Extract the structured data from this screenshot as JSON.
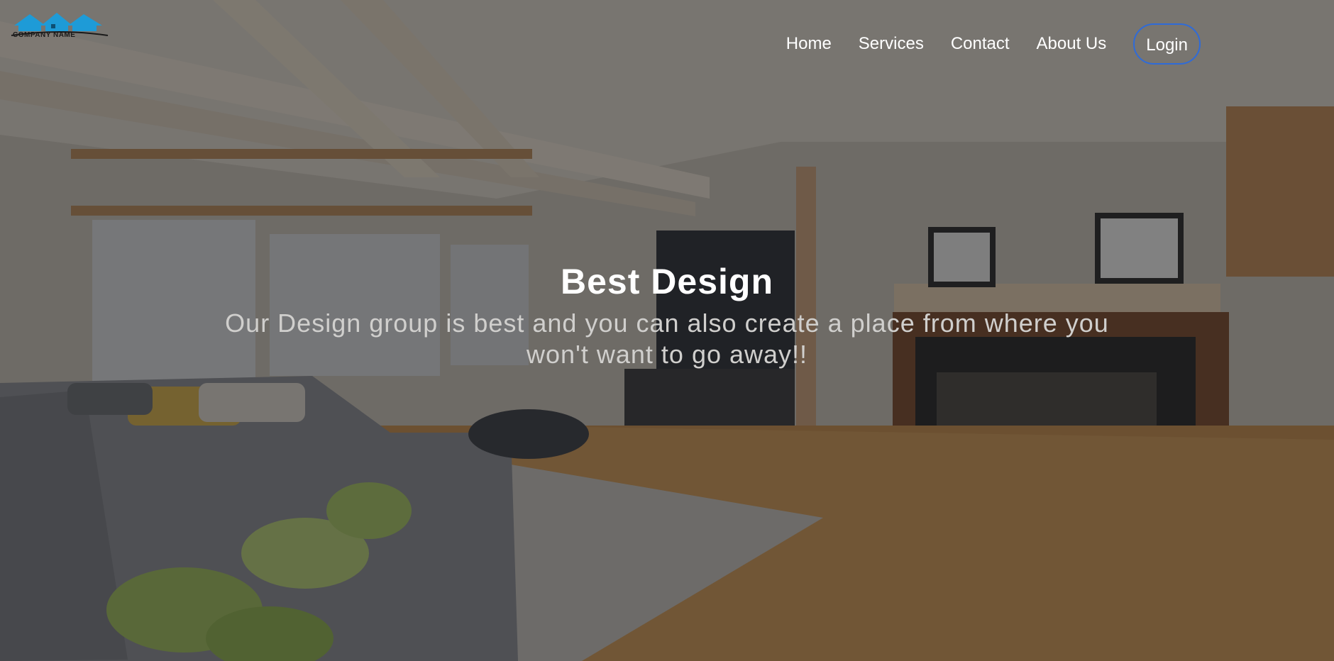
{
  "brand": {
    "company_name": "COMPANY NAME"
  },
  "nav": {
    "home": "Home",
    "services": "Services",
    "contact": "Contact",
    "about": "About Us",
    "login": "Login"
  },
  "hero": {
    "title": "Best Design",
    "subtitle": "Our Design group is best and you can also create a place from where you won't want to go away!!"
  },
  "colors": {
    "login_border": "#2f6bd8",
    "logo_blue": "#1e9bd7",
    "title": "#ffffff",
    "subtitle": "#d0cfcd"
  },
  "icons": {
    "logo": "house-roofs-logo-icon"
  }
}
